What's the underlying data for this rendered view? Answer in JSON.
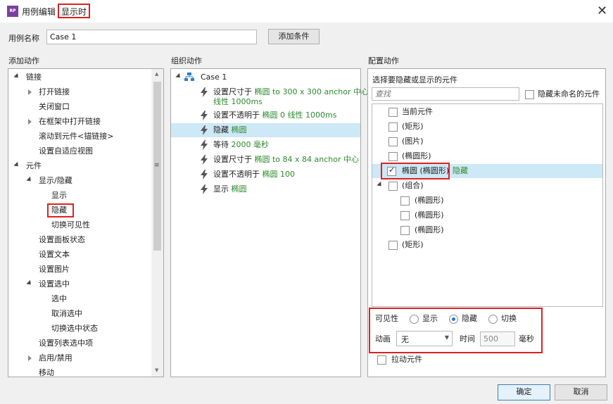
{
  "window": {
    "title": "用例编辑",
    "title_highlight": "显示时",
    "app_icon": "RP"
  },
  "case_name": {
    "label": "用例名称",
    "value": "Case 1"
  },
  "add_condition_button": "添加条件",
  "add_action": {
    "header": "添加动作",
    "items": [
      {
        "label": "链接"
      },
      {
        "label": "打开链接"
      },
      {
        "label": "关闭窗口"
      },
      {
        "label": "在框架中打开链接"
      },
      {
        "label": "滚动到元件<锚链接>"
      },
      {
        "label": "设置自适应视图"
      },
      {
        "label": "元件"
      },
      {
        "label": "显示/隐藏"
      },
      {
        "label": "显示"
      },
      {
        "label": "隐藏"
      },
      {
        "label": "切换可见性"
      },
      {
        "label": "设置面板状态"
      },
      {
        "label": "设置文本"
      },
      {
        "label": "设置图片"
      },
      {
        "label": "设置选中"
      },
      {
        "label": "选中"
      },
      {
        "label": "取消选中"
      },
      {
        "label": "切换选中状态"
      },
      {
        "label": "设置列表选中项"
      },
      {
        "label": "启用/禁用"
      },
      {
        "label": "移动"
      }
    ]
  },
  "organize": {
    "header": "组织动作",
    "case_label": "Case 1",
    "actions": [
      {
        "verb": "设置尺寸于",
        "detail": "椭圆 to 300 x 300 anchor 中心",
        "detail2": "线性 1000ms"
      },
      {
        "verb": "设置不透明于",
        "detail": "椭圆 0 线性 1000ms"
      },
      {
        "verb": "隐藏",
        "detail": "椭圆"
      },
      {
        "verb": "等待",
        "detail": "2000 毫秒"
      },
      {
        "verb": "设置尺寸于",
        "detail": "椭圆 to 84 x 84 anchor 中心"
      },
      {
        "verb": "设置不透明于",
        "detail": "椭圆 100"
      },
      {
        "verb": "显示",
        "detail": "椭圆"
      }
    ]
  },
  "configure": {
    "header": "配置动作",
    "subheader": "选择要隐藏或显示的元件",
    "search_placeholder": "查找",
    "hide_unnamed_label": "隐藏未命名的元件",
    "widgets": [
      {
        "label": "当前元件",
        "checked": false
      },
      {
        "label": "(矩形)",
        "checked": false
      },
      {
        "label": "(图片)",
        "checked": false
      },
      {
        "label": "(椭圆形)",
        "checked": false
      },
      {
        "label": "椭圆 (椭圆形)",
        "checked": true,
        "tag": "隐藏"
      },
      {
        "label": "(组合)",
        "checked": false
      },
      {
        "label": "(椭圆形)",
        "checked": false
      },
      {
        "label": "(椭圆形)",
        "checked": false
      },
      {
        "label": "(椭圆形)",
        "checked": false
      },
      {
        "label": "(矩形)",
        "checked": false
      }
    ],
    "visibility_label": "可见性",
    "vis_options": [
      {
        "label": "显示",
        "selected": false
      },
      {
        "label": "隐藏",
        "selected": true
      },
      {
        "label": "切换",
        "selected": false
      }
    ],
    "animation_label": "动画",
    "animation_value": "无",
    "time_label": "时间",
    "time_value": "500",
    "time_unit": "毫秒",
    "pull_widget_label": "拉动元件"
  },
  "ok_button": "确定",
  "cancel_button": "取消"
}
